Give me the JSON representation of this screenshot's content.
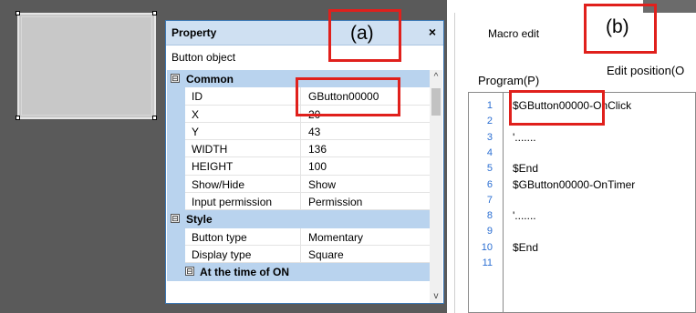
{
  "property_panel": {
    "title": "Property",
    "close": "×",
    "object": "Button object",
    "rows": [
      {
        "kind": "section",
        "toggle": "⊟",
        "label": "Common"
      },
      {
        "kind": "item",
        "name": "ID",
        "value": "GButton00000"
      },
      {
        "kind": "item",
        "name": "X",
        "value": "20"
      },
      {
        "kind": "item",
        "name": "Y",
        "value": "43"
      },
      {
        "kind": "item",
        "name": "WIDTH",
        "value": "136"
      },
      {
        "kind": "item",
        "name": "HEIGHT",
        "value": "100"
      },
      {
        "kind": "item",
        "name": "Show/Hide",
        "value": "Show"
      },
      {
        "kind": "item",
        "name": "Input permission",
        "value": "Permission"
      },
      {
        "kind": "section",
        "toggle": "⊟",
        "label": "Style"
      },
      {
        "kind": "item",
        "name": "Button type",
        "value": "Momentary"
      },
      {
        "kind": "item",
        "name": "Display type",
        "value": "Square"
      },
      {
        "kind": "subsection",
        "toggle": "⊟",
        "label": "At the time of ON"
      }
    ],
    "scroll_up": "^",
    "scroll_down": "v"
  },
  "macro_panel": {
    "tab": "Macro edit",
    "edit_position": "Edit position(O",
    "program_label": "Program(P)",
    "lines": [
      {
        "n": "1",
        "code": "$GButton00000-OnClick"
      },
      {
        "n": "2",
        "code": ""
      },
      {
        "n": "3",
        "code": "'......."
      },
      {
        "n": "4",
        "code": ""
      },
      {
        "n": "5",
        "code": "$End"
      },
      {
        "n": "6",
        "code": "$GButton00000-OnTimer"
      },
      {
        "n": "7",
        "code": ""
      },
      {
        "n": "8",
        "code": "'......."
      },
      {
        "n": "9",
        "code": ""
      },
      {
        "n": "10",
        "code": "$End"
      },
      {
        "n": "11",
        "code": ""
      }
    ]
  },
  "annotations": {
    "a": "(a)",
    "b": "(b)"
  },
  "colors": {
    "annotation_red": "#e0201c",
    "panel_header": "#cfe0f2",
    "section_bg": "#b9d3ee",
    "line_number": "#2a6ed2"
  }
}
